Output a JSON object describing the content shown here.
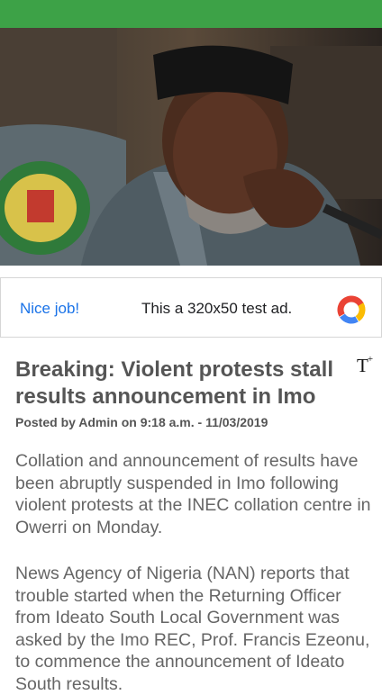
{
  "ad": {
    "nice_job": "Nice job!",
    "text": "This a 320x50 test ad."
  },
  "toolbar": {
    "text_size_label": "T",
    "text_size_plus": "+"
  },
  "article": {
    "title": "Breaking: Violent protests stall results announcement in Imo",
    "meta": "Posted by Admin on 9:18 a.m. - 11/03/2019",
    "paragraphs": [
      "Collation and announcement of results have been abruptly suspended in Imo following violent protests at the INEC collation centre in Owerri on Monday.",
      "News Agency of Nigeria (NAN) reports that trouble started when the Returning Officer from Ideato South Local Government was asked by the Imo REC, Prof. Francis Ezeonu, to commence the announcement of Ideato South results."
    ]
  },
  "colors": {
    "top_bar": "#3da247",
    "ad_link": "#1a73e8",
    "title": "#555555",
    "body_text": "#666666"
  }
}
